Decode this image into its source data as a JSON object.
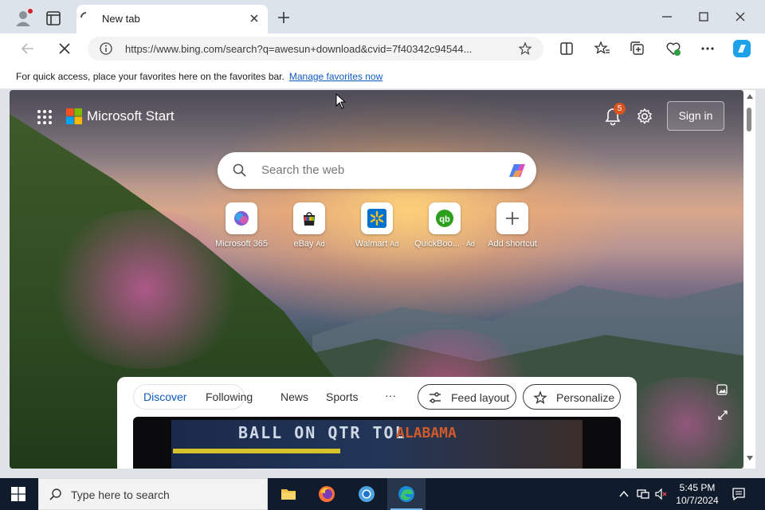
{
  "browser": {
    "tab": {
      "title": "New tab"
    },
    "address": {
      "url": "https://www.bing.com/search?q=awesun+download&cvid=7f40342c94544..."
    },
    "favorites_bar": {
      "message": "For quick access, place your favorites here on the favorites bar.",
      "link": "Manage favorites now"
    }
  },
  "page": {
    "brand": "Microsoft Start",
    "notifications_count": "5",
    "signin_label": "Sign in",
    "search_placeholder": "Search the web",
    "shortcuts": [
      {
        "label": "Microsoft 365",
        "ad": ""
      },
      {
        "label": "eBay",
        "ad": "Ad"
      },
      {
        "label": "Walmart",
        "ad": "Ad"
      },
      {
        "label": "QuickBoo...",
        "ad": "· Ad"
      },
      {
        "label": "Add shortcut",
        "ad": ""
      }
    ],
    "feed": {
      "tabs": [
        "Discover",
        "Following"
      ],
      "links": [
        "News",
        "Sports"
      ],
      "more": "···",
      "feed_layout": "Feed layout",
      "personalize": "Personalize",
      "video": {
        "top_text": "BALL ON  QTR  TOL",
        "team": "ALABAMA"
      }
    }
  },
  "taskbar": {
    "search_placeholder": "Type here to search",
    "time": "5:45 PM",
    "date": "10/7/2024"
  },
  "colors": {
    "accent": "#0f5bc2",
    "badge": "#d9541e",
    "taskbar": "#101b2b"
  }
}
